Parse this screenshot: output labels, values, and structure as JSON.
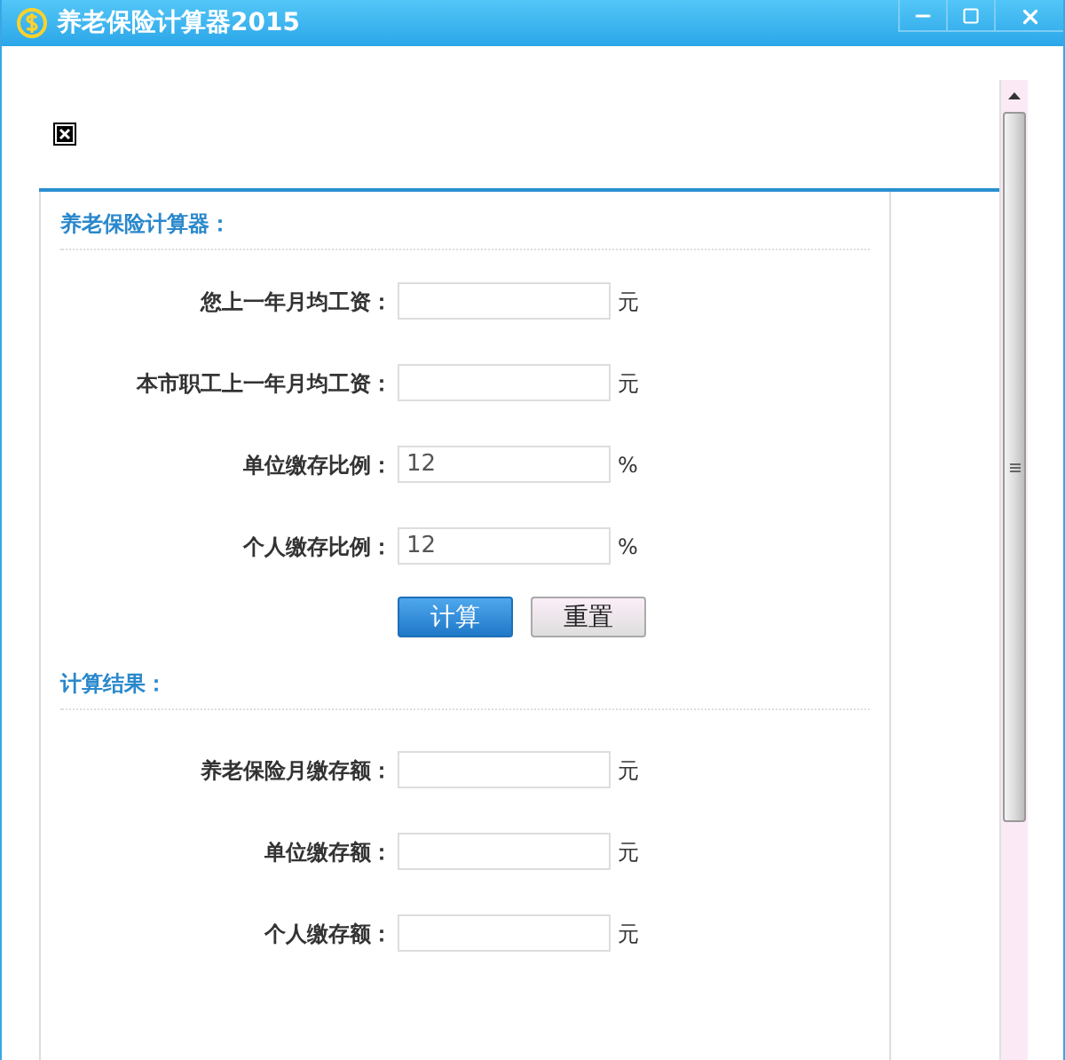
{
  "window": {
    "title": "养老保险计算器2015"
  },
  "sections": [
    {
      "title": "养老保险计算器：",
      "fields": [
        {
          "label": "您上一年月均工资：",
          "unit": "元"
        },
        {
          "label": "本市职工上一年月均工资：",
          "unit": "元"
        },
        {
          "label": "单位缴存比例：",
          "value": "12",
          "unit": "%"
        },
        {
          "label": "个人缴存比例：",
          "value": "12",
          "unit": "%"
        }
      ],
      "buttons": [
        {
          "label": "计算",
          "kind": "primary"
        },
        {
          "label": "重置",
          "kind": "secondary"
        }
      ]
    },
    {
      "title": "计算结果：",
      "fields": [
        {
          "label": "养老保险月缴存额：",
          "unit": "元"
        },
        {
          "label": "单位缴存额：",
          "unit": "元"
        },
        {
          "label": "个人缴存额：",
          "unit": "元"
        }
      ]
    }
  ]
}
